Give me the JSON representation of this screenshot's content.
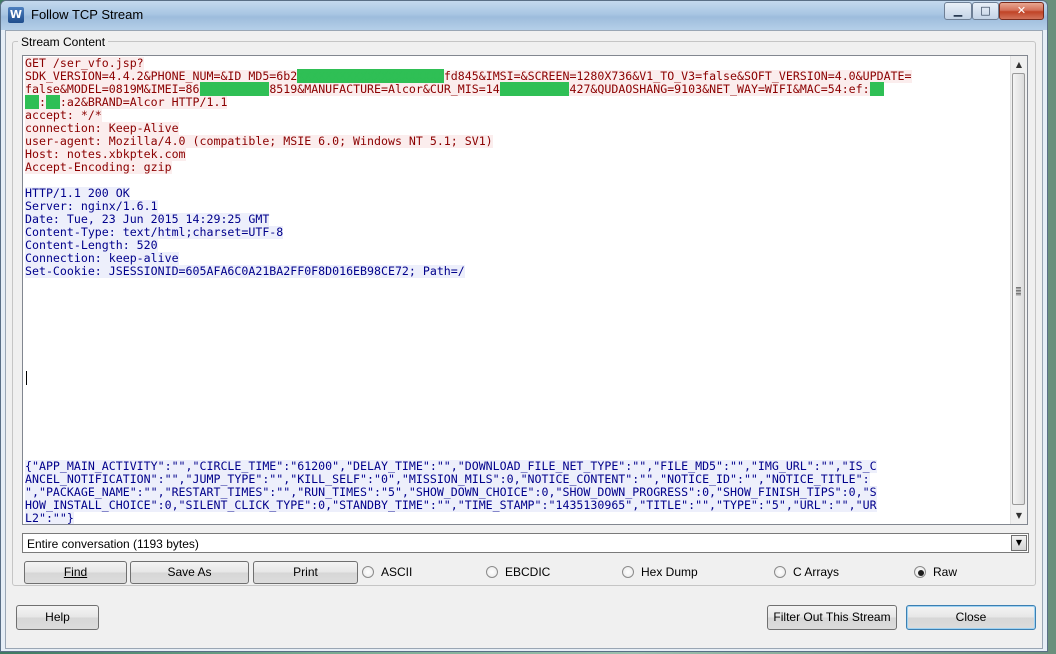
{
  "window": {
    "title": "Follow TCP Stream",
    "minimize": "▁",
    "maximize": "□",
    "close": "✕"
  },
  "stream": {
    "group_label": "Stream Content",
    "request_lines": [
      "GET /ser_vfo.jsp?",
      "SDK_VERSION=4.4.2&PHONE_NUM=&ID_MD5=6b2",
      "fd845&IMSI=&SCREEN=1280X736&V1_TO_V3=false&SOFT_VERSION=4.0&UPDATE=",
      "false&MODEL=0819M&IMEI=86",
      "8519&MANUFACTURE=Alcor&CUR_MIS=14",
      "427&QUDAOSHANG=9103&NET_WAY=WIFI&MAC=54:ef:",
      ":a2&BRAND=Alcor HTTP/1.1",
      "accept: */*",
      "connection: Keep-Alive",
      "user-agent: Mozilla/4.0 (compatible; MSIE 6.0; Windows NT 5.1; SV1)",
      "Host: notes.xbkptek.com",
      "Accept-Encoding: gzip"
    ],
    "response_lines": [
      "HTTP/1.1 200 OK",
      "Server: nginx/1.6.1",
      "Date: Tue, 23 Jun 2015 14:29:25 GMT",
      "Content-Type: text/html;charset=UTF-8",
      "Content-Length: 520",
      "Connection: keep-alive",
      "Set-Cookie: JSESSIONID=605AFA6C0A21BA2FF0F8D016EB98CE72; Path=/"
    ],
    "body_lines": [
      "{\"APP_MAIN_ACTIVITY\":\"\",\"CIRCLE_TIME\":\"61200\",\"DELAY_TIME\":\"\",\"DOWNLOAD_FILE_NET_TYPE\":\"\",\"FILE_MD5\":\"\",\"IMG_URL\":\"\",\"IS_C",
      "ANCEL_NOTIFICATION\":\"\",\"JUMP_TYPE\":\"\",\"KILL_SELF\":\"0\",\"MISSION_MILS\":0,\"NOTICE_CONTENT\":\"\",\"NOTICE_ID\":\"\",\"NOTICE_TITLE\":",
      "\",\"PACKAGE_NAME\":\"\",\"RESTART_TIMES\":\"\",\"RUN_TIMES\":\"5\",\"SHOW_DOWN_CHOICE\":0,\"SHOW_DOWN_PROGRESS\":0,\"SHOW_FINISH_TIPS\":0,\"S",
      "HOW_INSTALL_CHOICE\":0,\"SILENT_CLICK_TYPE\":0,\"STANDBY_TIME\":\"\",\"TIME_STAMP\":\"1435130965\",\"TITLE\":\"\",\"TYPE\":\"5\",\"URL\":\"\",\"UR",
      "L2\":\"\"}"
    ]
  },
  "conversation_select": {
    "value": "Entire conversation (1193 bytes)"
  },
  "buttons": {
    "find": "Find",
    "save_as": "Save As",
    "print": "Print",
    "help": "Help",
    "filter_out": "Filter Out This Stream",
    "close": "Close"
  },
  "formats": [
    {
      "label": "ASCII",
      "selected": false
    },
    {
      "label": "EBCDIC",
      "selected": false
    },
    {
      "label": "Hex Dump",
      "selected": false
    },
    {
      "label": "C Arrays",
      "selected": false
    },
    {
      "label": "Raw",
      "selected": true
    }
  ]
}
